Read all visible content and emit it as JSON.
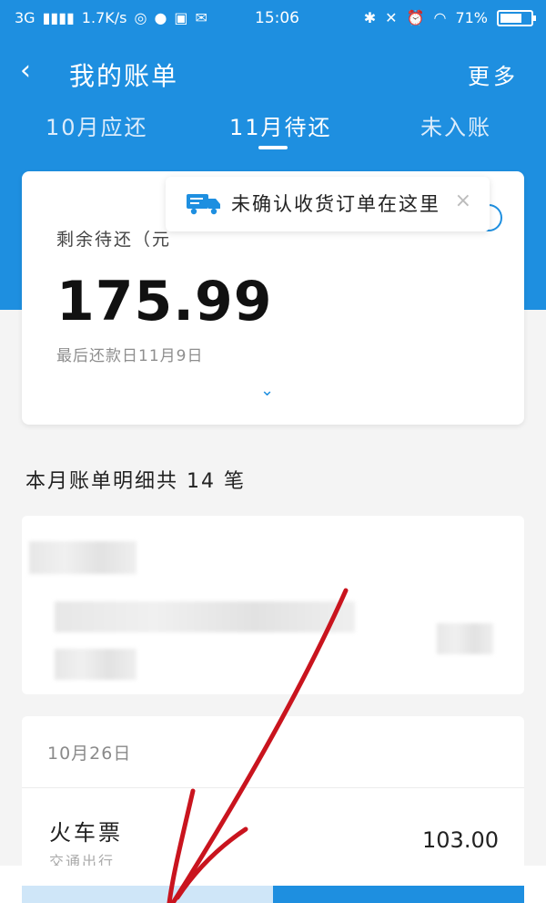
{
  "status_bar": {
    "network": "3G",
    "speed": "1.7K/s",
    "time": "15:06",
    "battery": "71%",
    "battery_level": 0.71
  },
  "header": {
    "title": "我的账单",
    "more": "更多",
    "back_icon": "chevron-left-icon"
  },
  "tabs": [
    {
      "label": "10月应还",
      "active": false
    },
    {
      "label": "11月待还",
      "active": true
    },
    {
      "label": "未入账",
      "active": false
    }
  ],
  "summary": {
    "label": "剩余待还（元）",
    "label_visible": "剩余待还（元",
    "amount": "175.99",
    "due": "最后还款日11月9日",
    "expand_icon": "chevron-down-icon"
  },
  "tooltip": {
    "text": "未确认收货订单在这里",
    "close": "×"
  },
  "list": {
    "section_title": "本月账单明细共 14 笔",
    "groups": [
      {
        "date": "10月26日",
        "items": [
          {
            "title": "火车票",
            "subtitle": "交通出行",
            "amount": "103.00"
          }
        ]
      }
    ]
  },
  "colors": {
    "primary": "#1e8fe0",
    "annotation": "#c9141e"
  }
}
